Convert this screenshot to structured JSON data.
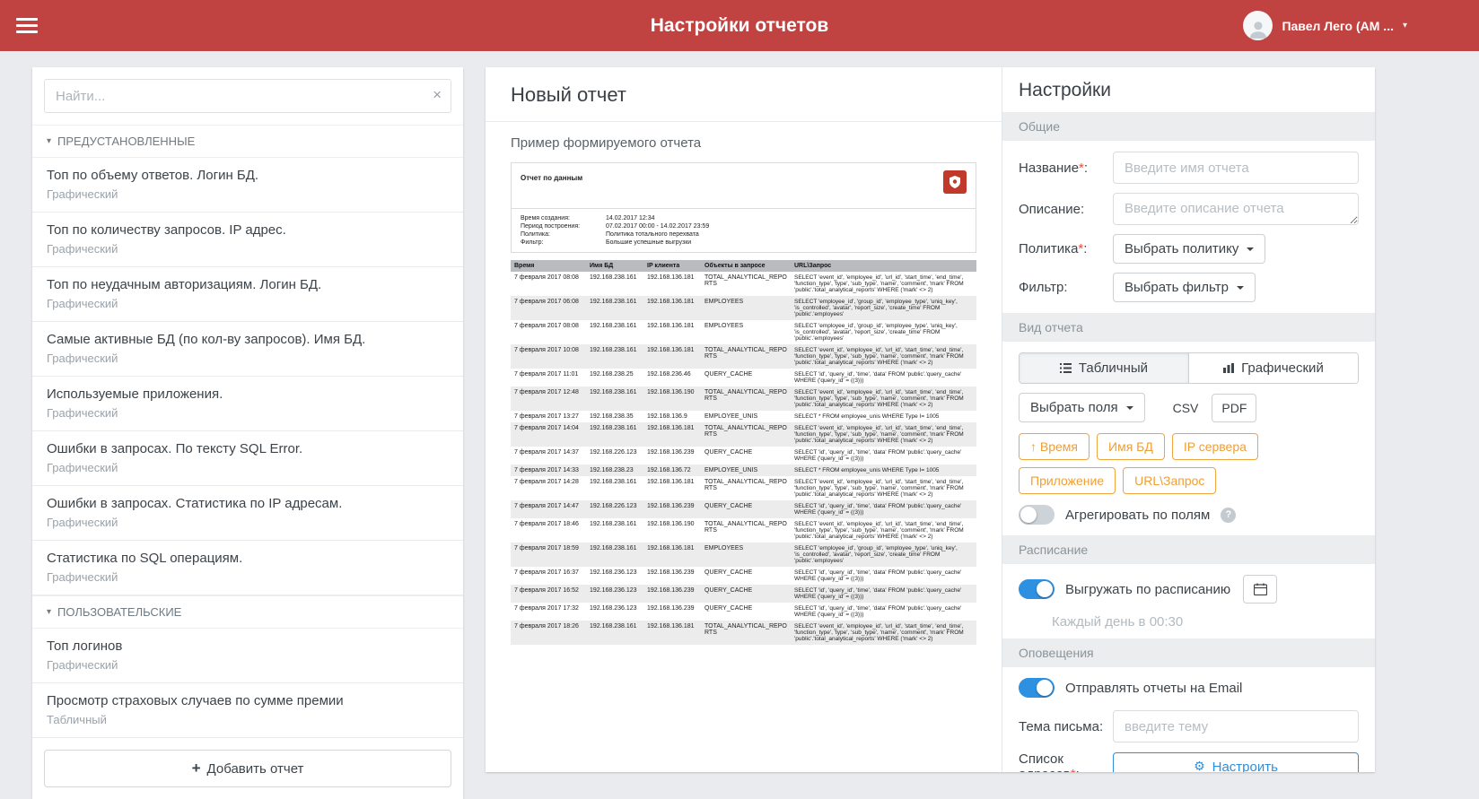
{
  "icons": {
    "chevron_down": "▾",
    "close": "×",
    "plus": "+",
    "gear": "⚙",
    "help": "?"
  },
  "header": {
    "title": "Настройки отчетов",
    "user_name": "Павел Лего (АМ ..."
  },
  "sidebar": {
    "search_placeholder": "Найти...",
    "preset": {
      "label": "ПРЕДУСТАНОВЛЕННЫЕ",
      "items": [
        {
          "title": "Топ по объему ответов. Логин БД.",
          "type": "Графический"
        },
        {
          "title": "Топ по количеству запросов. IP адрес.",
          "type": "Графический"
        },
        {
          "title": "Топ по неудачным авторизациям. Логин БД.",
          "type": "Графический"
        },
        {
          "title": "Самые активные БД (по кол-ву запросов). Имя БД.",
          "type": "Графический"
        },
        {
          "title": "Используемые приложения.",
          "type": "Графический"
        },
        {
          "title": "Ошибки в запросах. По тексту SQL Error.",
          "type": "Графический"
        },
        {
          "title": "Ошибки в запросах. Статистика по IP адресам.",
          "type": "Графический"
        },
        {
          "title": "Статистика по SQL операциям.",
          "type": "Графический"
        }
      ]
    },
    "custom": {
      "label": "ПОЛЬЗОВАТЕЛЬСКИЕ",
      "items": [
        {
          "title": "Топ логинов",
          "type": "Графический"
        },
        {
          "title": "Просмотр страховых случаев по сумме премии",
          "type": "Табличный"
        }
      ]
    },
    "add_button": "Добавить отчет"
  },
  "report": {
    "title": "Новый отчет",
    "preview_caption": "Пример формируемого отчета",
    "preview": {
      "heading": "Отчет по данным",
      "meta": [
        {
          "label": "Время создания:",
          "value": "14.02.2017 12:34"
        },
        {
          "label": "Период построения:",
          "value": "07.02.2017 00:00 - 14.02.2017 23:59"
        },
        {
          "label": "Политика:",
          "value": "Политика тотального перехвата"
        },
        {
          "label": "Фильтр:",
          "value": "Большие успешные выгрузки"
        }
      ],
      "columns": [
        "Время",
        "Имя БД",
        "IP клиента",
        "Объекты в запросе",
        "URL\\Запрос"
      ],
      "rows": [
        {
          "time": "7 февраля 2017 08:08",
          "db": "192.168.238.161",
          "client": "192.168.136.181",
          "objects": "TOTAL_ANALYTICAL_REPORTS",
          "query": "SELECT 'event_id', 'employee_id', 'url_id', 'start_time', 'end_time', 'function_type', 'type', 'sub_type', 'name', 'comment', 'mark' FROM 'public'.'total_analytical_reports' WHERE ('mark' <> 2)"
        },
        {
          "time": "7 февраля 2017 06:08",
          "db": "192.168.238.161",
          "client": "192.168.136.181",
          "objects": "EMPLOYEES",
          "query": "SELECT 'employee_id', 'group_id', 'employee_type', 'uniq_key', 'is_controlled', 'avatar', 'report_size', 'create_time' FROM 'public'.'employees'"
        },
        {
          "time": "7 февраля 2017 08:08",
          "db": "192.168.238.161",
          "client": "192.168.136.181",
          "objects": "EMPLOYEES",
          "query": "SELECT 'employee_id', 'group_id', 'employee_type', 'uniq_key', 'is_controlled', 'avatar', 'report_size', 'create_time' FROM 'public'.'employees'"
        },
        {
          "time": "7 февраля 2017 10:08",
          "db": "192.168.238.161",
          "client": "192.168.136.181",
          "objects": "TOTAL_ANALYTICAL_REPORTS",
          "query": "SELECT 'event_id', 'employee_id', 'url_id', 'start_time', 'end_time', 'function_type', 'type', 'sub_type', 'name', 'comment', 'mark' FROM 'public'.'total_analytical_reports' WHERE ('mark' <> 2)"
        },
        {
          "time": "7 февраля 2017 11:01",
          "db": "192.168.238.25",
          "client": "192.168.236.46",
          "objects": "QUERY_CACHE",
          "query": "SELECT 'id', 'query_id', 'time', 'data' FROM 'public'.'query_cache' WHERE ('query_id' = ((3)))"
        },
        {
          "time": "7 февраля 2017 12:48",
          "db": "192.168.238.161",
          "client": "192.168.136.190",
          "objects": "TOTAL_ANALYTICAL_REPORTS",
          "query": "SELECT 'event_id', 'employee_id', 'url_id', 'start_time', 'end_time', 'function_type', 'type', 'sub_type', 'name', 'comment', 'mark' FROM 'public'.'total_analytical_reports' WHERE ('mark' <> 2)"
        },
        {
          "time": "7 февраля 2017 13:27",
          "db": "192.168.238.35",
          "client": "192.168.136.9",
          "objects": "EMPLOYEE_UNIS",
          "query": "SELECT * FROM employee_unis WHERE Type I= 1005"
        },
        {
          "time": "7 февраля 2017 14:04",
          "db": "192.168.238.161",
          "client": "192.168.136.181",
          "objects": "TOTAL_ANALYTICAL_REPORTS",
          "query": "SELECT 'event_id', 'employee_id', 'url_id', 'start_time', 'end_time', 'function_type', 'type', 'sub_type', 'name', 'comment', 'mark' FROM 'public'.'total_analytical_reports' WHERE ('mark' <> 2)"
        },
        {
          "time": "7 февраля 2017 14:37",
          "db": "192.168.226.123",
          "client": "192.168.136.239",
          "objects": "QUERY_CACHE",
          "query": "SELECT 'id', 'query_id', 'time', 'data' FROM 'public'.'query_cache' WHERE ('query_id' = ((3)))"
        },
        {
          "time": "7 февраля 2017 14:33",
          "db": "192.168.238.23",
          "client": "192.168.136.72",
          "objects": "EMPLOYEE_UNIS",
          "query": "SELECT * FROM employee_unis WHERE Type I= 1005"
        },
        {
          "time": "7 февраля 2017 14:28",
          "db": "192.168.238.161",
          "client": "192.168.136.181",
          "objects": "TOTAL_ANALYTICAL_REPORTS",
          "query": "SELECT 'event_id', 'employee_id', 'url_id', 'start_time', 'end_time', 'function_type', 'type', 'sub_type', 'name', 'comment', 'mark' FROM 'public'.'total_analytical_reports' WHERE ('mark' <> 2)"
        },
        {
          "time": "7 февраля 2017 14:47",
          "db": "192.168.226.123",
          "client": "192.168.136.239",
          "objects": "QUERY_CACHE",
          "query": "SELECT 'id', 'query_id', 'time', 'data' FROM 'public'.'query_cache' WHERE ('query_id' = ((3)))"
        },
        {
          "time": "7 февраля 2017 18:46",
          "db": "192.168.238.161",
          "client": "192.168.136.190",
          "objects": "TOTAL_ANALYTICAL_REPORTS",
          "query": "SELECT 'event_id', 'employee_id', 'url_id', 'start_time', 'end_time', 'function_type', 'type', 'sub_type', 'name', 'comment', 'mark' FROM 'public'.'total_analytical_reports' WHERE ('mark' <> 2)"
        },
        {
          "time": "7 февраля 2017 18:59",
          "db": "192.168.238.161",
          "client": "192.168.136.181",
          "objects": "EMPLOYEES",
          "query": "SELECT 'employee_id', 'group_id', 'employee_type', 'uniq_key', 'is_controlled', 'avatar', 'report_size', 'create_time' FROM 'public'.'employees'"
        },
        {
          "time": "7 февраля 2017 16:37",
          "db": "192.168.236.123",
          "client": "192.168.136.239",
          "objects": "QUERY_CACHE",
          "query": "SELECT 'id', 'query_id', 'time', 'data' FROM 'public'.'query_cache' WHERE ('query_id' = ((3)))"
        },
        {
          "time": "7 февраля 2017 16:52",
          "db": "192.168.236.123",
          "client": "192.168.136.239",
          "objects": "QUERY_CACHE",
          "query": "SELECT 'id', 'query_id', 'time', 'data' FROM 'public'.'query_cache' WHERE ('query_id' = ((3)))"
        },
        {
          "time": "7 февраля 2017 17:32",
          "db": "192.168.236.123",
          "client": "192.168.136.239",
          "objects": "QUERY_CACHE",
          "query": "SELECT 'id', 'query_id', 'time', 'data' FROM 'public'.'query_cache' WHERE ('query_id' = ((3)))"
        },
        {
          "time": "7 февраля 2017 18:26",
          "db": "192.168.238.161",
          "client": "192.168.136.181",
          "objects": "TOTAL_ANALYTICAL_REPORTS",
          "query": "SELECT 'event_id', 'employee_id', 'url_id', 'start_time', 'end_time', 'function_type', 'type', 'sub_type', 'name', 'comment', 'mark' FROM 'public'.'total_analytical_reports' WHERE ('mark' <> 2)"
        }
      ]
    }
  },
  "settings": {
    "title": "Настройки",
    "colon": ":",
    "required_mark": "*",
    "general": {
      "label": "Общие",
      "name_label": "Название",
      "name_placeholder": "Введите имя отчета",
      "desc_label": "Описание",
      "desc_placeholder": "Введите описание отчета",
      "policy_label": "Политика",
      "policy_button": "Выбрать политику",
      "filter_label": "Фильтр",
      "filter_button": "Выбрать фильтр"
    },
    "view": {
      "label": "Вид отчета",
      "tab_table": "Табличный",
      "tab_graphic": "Графический",
      "active_tab": "Табличный",
      "fields_button": "Выбрать поля",
      "csv_button": "CSV",
      "pdf_button": "PDF",
      "active_format": "PDF",
      "chips": [
        {
          "label": "↑ Время"
        },
        {
          "label": "Имя БД"
        },
        {
          "label": "IP сервера"
        },
        {
          "label": "Приложение"
        },
        {
          "label": "URL\\Запрос"
        }
      ],
      "aggregate_label": "Агрегировать по полям",
      "aggregate_on": false
    },
    "schedule": {
      "label": "Расписание",
      "toggle_label": "Выгружать по расписанию",
      "toggle_on": true,
      "time_text": "Каждый день в 00:30"
    },
    "notifications": {
      "label": "Оповещения",
      "email_label": "Отправлять отчеты на Email",
      "email_on": true,
      "subject_label": "Тема письма",
      "subject_placeholder": "введите тему",
      "recipients_label": "Список адресов",
      "configure_button": "Настроить"
    }
  },
  "colors": {
    "topbar": "#c04341",
    "accent_blue": "#2e90e0",
    "chip_orange": "#f0a63f",
    "logo_red": "#c0392b"
  }
}
